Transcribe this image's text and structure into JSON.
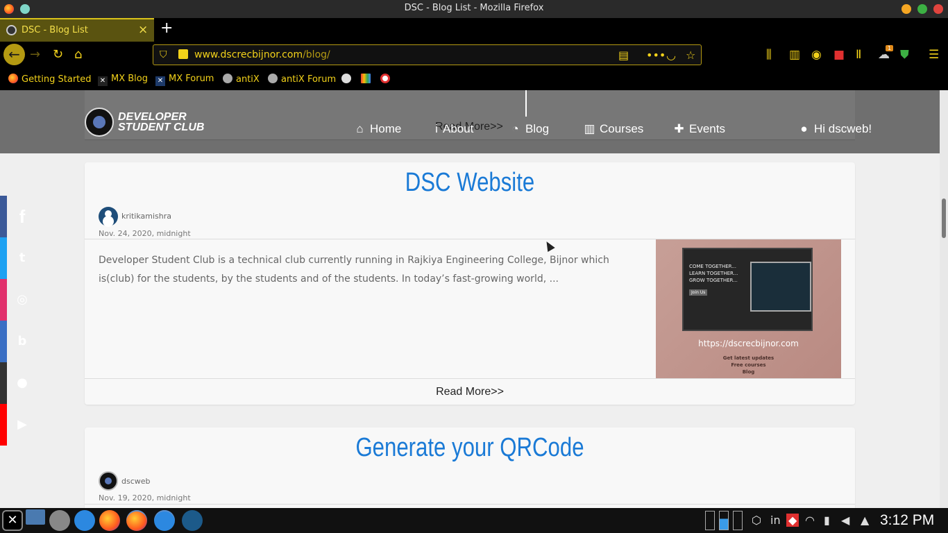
{
  "window": {
    "title": "DSC - Blog List - Mozilla Firefox",
    "buttons": {
      "minimize_color": "#f5a623",
      "maximize_color": "#3cb043",
      "close_color": "#e0443e"
    }
  },
  "tabs": [
    {
      "label": "DSC - Blog List",
      "close": "×",
      "active": true
    }
  ],
  "new_tab": "+",
  "toolbar": {
    "url_host": "www.dscrecbijnor.com",
    "url_path": "/blog/",
    "badge": "1"
  },
  "bookmarks": [
    {
      "label": "Getting Started",
      "icon": "firefox-icon"
    },
    {
      "label": "MX Blog",
      "icon": "mx-icon"
    },
    {
      "label": "MX Forum",
      "icon": "mx-icon"
    },
    {
      "label": "antiX",
      "icon": "antix-icon"
    },
    {
      "label": "antiX Forum",
      "icon": "antix-icon"
    }
  ],
  "site": {
    "logo_text": "Developer Student Club",
    "ghost_read_more": "Read More>>",
    "nav": [
      {
        "label": "Home",
        "icon": "home-icon"
      },
      {
        "label": "About",
        "icon": "info-icon"
      },
      {
        "label": "Blog",
        "icon": "rss-icon"
      },
      {
        "label": "Courses",
        "icon": "book-icon"
      },
      {
        "label": "Events",
        "icon": "puzzle-icon"
      },
      {
        "label": "Hi dscweb!",
        "icon": "user-icon"
      }
    ]
  },
  "posts": [
    {
      "title": "DSC Website",
      "author": "kritikamishra",
      "date": "Nov. 24, 2020, midnight",
      "excerpt": "Developer Student Club is a technical club currently running in Rajkiya Engineering College, Bijnor which is(club) for the students, by the students and of the students. In today’s fast-growing world, ...",
      "image": {
        "hero_lines": [
          "COME TOGETHER...",
          "LEARN TOGETHER...",
          "GROW TOGETHER..."
        ],
        "join_label": "Join Us",
        "site_url": "https://dscrecbijnor.com",
        "features": [
          "Get latest updates",
          "Free courses",
          "Blog"
        ]
      },
      "read_more": "Read More>>"
    },
    {
      "title": "Generate your QRCode",
      "author": "dscweb",
      "date": "Nov. 19, 2020, midnight"
    }
  ],
  "social": [
    {
      "icon": "facebook-icon",
      "glyph": "f",
      "color": "#3b5998"
    },
    {
      "icon": "twitter-icon",
      "glyph": "t",
      "color": "#1da1f2"
    },
    {
      "icon": "instagram-icon",
      "glyph": "◎",
      "color": "#e1306c"
    },
    {
      "icon": "blog-icon",
      "glyph": "b",
      "color": "#3a6fc4"
    },
    {
      "icon": "github-icon",
      "glyph": "●",
      "color": "#333333"
    },
    {
      "icon": "youtube-icon",
      "glyph": "▶",
      "color": "#ff0000"
    }
  ],
  "taskbar": {
    "clock": "3:12 PM",
    "tray_text": "in"
  },
  "colors": {
    "accent_yellow": "#f3d21a",
    "link_blue": "#1a7ad6",
    "header_gray": "#6f6f6f"
  }
}
